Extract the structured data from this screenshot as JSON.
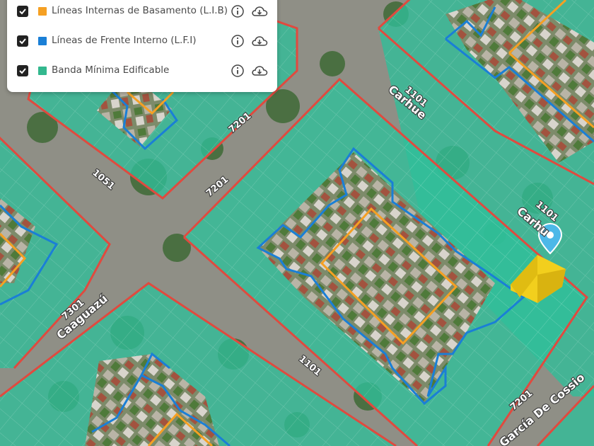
{
  "layers": [
    {
      "label": "Líneas Internas de Basamento (L.I.B)",
      "color": "#f5a023",
      "checked": true,
      "icons": [
        "info-icon",
        "cloud-download-icon"
      ]
    },
    {
      "label": "Líneas de Frente Interno (L.F.I)",
      "color": "#1a7fd6",
      "checked": true,
      "icons": [
        "info-icon",
        "cloud-download-icon"
      ]
    },
    {
      "label": "Banda Mínima Edificable",
      "color": "#33b88e",
      "checked": true,
      "icons": [
        "info-icon",
        "cloud-download-icon"
      ]
    }
  ],
  "map": {
    "block_fill": "#2fbf9a",
    "block_border": "#e04a3f",
    "lib_color": "#f5a023",
    "lfi_color": "#1a7fd6",
    "marker_color": "#4cb8e8",
    "building_color": "#f2cf1d",
    "street_labels": {
      "l1101_top": "1101",
      "carhue_top": "Carhue",
      "l7201_upper": "7201",
      "l1051": "1051",
      "l7201_mid": "7201",
      "l1101_right": "1101",
      "carhue_right": "Carhu",
      "l7301": "7301",
      "caaguazu": "Caaguazú",
      "l1101_bottom": "1101",
      "l7201_bottom": "7201",
      "garcia_de_cossio": "García De Cossio"
    }
  }
}
